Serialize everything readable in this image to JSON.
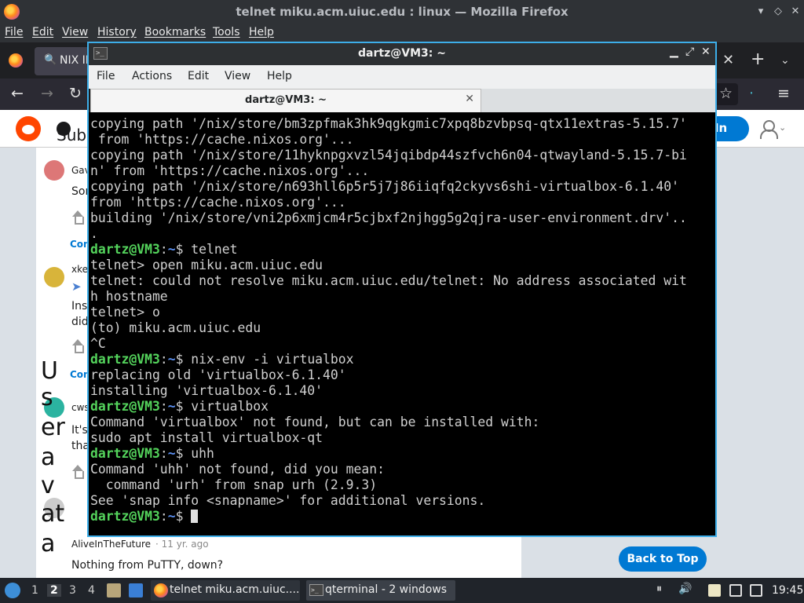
{
  "firefox": {
    "title": "telnet miku.acm.uiuc.edu : linux — Mozilla Firefox",
    "menu": [
      "File",
      "Edit",
      "View",
      "History",
      "Bookmarks",
      "Tools",
      "Help"
    ],
    "tab_label": "NIX II"
  },
  "reddit": {
    "sub_fragment": "Subr",
    "login_label": "g In",
    "back_to_top": "Back to Top",
    "comments": [
      {
        "author": "Gav",
        "text": "Sor",
        "continue": "Con"
      },
      {
        "author": "xke",
        "text": "Ins",
        "text2": "did",
        "continue": "Con"
      },
      {
        "author": "cws",
        "text": "It's",
        "text2": "tha"
      },
      {
        "author": "AliveInTheFuture",
        "time": "· 11 yr. ago",
        "text": "Nothing from PuTTY, down?"
      }
    ],
    "stray_chars": [
      "U",
      "s",
      "er",
      "a",
      "v",
      "at",
      "a"
    ]
  },
  "qterminal": {
    "title": "dartz@VM3: ~",
    "menu": [
      "File",
      "Actions",
      "Edit",
      "View",
      "Help"
    ],
    "tab_label": "dartz@VM3: ~",
    "prompt_user": "dartz@VM3",
    "prompt_path": "~",
    "lines": [
      {
        "t": "copying path '/nix/store/bm3zpfmak3hk9qgkgmic7xpq8bzvbpsq-qtx11extras-5.15.7'"
      },
      {
        "t": " from 'https://cache.nixos.org'..."
      },
      {
        "t": "copying path '/nix/store/11hyknpgxvzl54jqibdp44szfvch6n04-qtwayland-5.15.7-bi"
      },
      {
        "t": "n' from 'https://cache.nixos.org'..."
      },
      {
        "t": "copying path '/nix/store/n693hll6p5r5j7j86iiqfq2ckyvs6shi-virtualbox-6.1.40'"
      },
      {
        "t": "from 'https://cache.nixos.org'..."
      },
      {
        "t": "building '/nix/store/vni2p6xmjcm4r5cjbxf2njhgg5g2qjra-user-environment.drv'.."
      },
      {
        "t": "."
      },
      {
        "p": true,
        "t": "telnet"
      },
      {
        "t": "telnet> open miku.acm.uiuc.edu"
      },
      {
        "t": "telnet: could not resolve miku.acm.uiuc.edu/telnet: No address associated wit"
      },
      {
        "t": "h hostname"
      },
      {
        "t": "telnet> o"
      },
      {
        "t": "(to) miku.acm.uiuc.edu"
      },
      {
        "t": "^C"
      },
      {
        "p": true,
        "t": "nix-env -i virtualbox"
      },
      {
        "t": "replacing old 'virtualbox-6.1.40'"
      },
      {
        "t": "installing 'virtualbox-6.1.40'"
      },
      {
        "p": true,
        "t": "virtualbox"
      },
      {
        "t": "Command 'virtualbox' not found, but can be installed with:"
      },
      {
        "t": "sudo apt install virtualbox-qt"
      },
      {
        "p": true,
        "t": "uhh"
      },
      {
        "t": "Command 'uhh' not found, did you mean:"
      },
      {
        "t": "  command 'urh' from snap urh (2.9.3)"
      },
      {
        "t": "See 'snap info <snapname>' for additional versions."
      },
      {
        "p": true,
        "t": "",
        "cursor": true
      }
    ]
  },
  "taskbar": {
    "workspaces": [
      "1",
      "2",
      "3",
      "4"
    ],
    "active_workspace": "2",
    "tasks": [
      {
        "label": "telnet miku.acm.uiuc...."
      },
      {
        "label": "qterminal - 2 windows"
      }
    ],
    "clock": "19:45"
  }
}
